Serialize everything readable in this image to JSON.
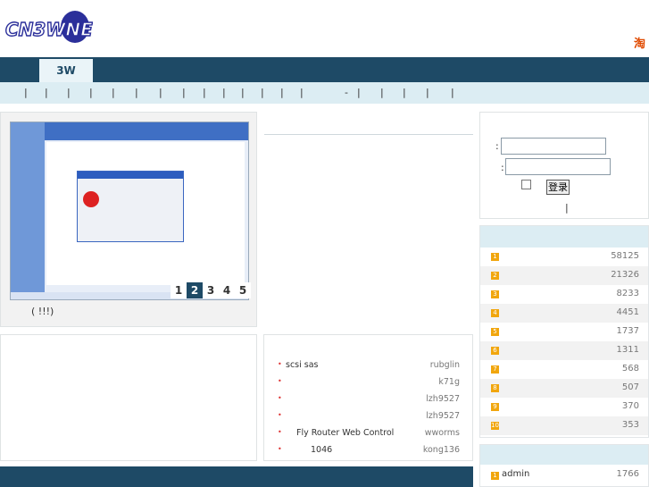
{
  "header": {
    "logo_text": "CN3WNE",
    "right_link": "淘"
  },
  "nav": {
    "active_tab": "3W"
  },
  "subnav": {
    "separators": [
      "|",
      "|",
      "|",
      "|",
      "|",
      "|",
      "|",
      "|",
      "|",
      "|",
      "|",
      "|",
      "|",
      "|",
      "-",
      "|",
      "|",
      "|",
      "|",
      "|"
    ]
  },
  "slideshow": {
    "caption": "(    !!!)",
    "pages": [
      "1",
      "2",
      "3",
      "4",
      "5"
    ],
    "active_page": "2"
  },
  "login": {
    "field1_prefix": ":",
    "field2_prefix": ":",
    "login_button": "登录",
    "divider": "|"
  },
  "ranking": {
    "rows": [
      {
        "num": "1",
        "value": "58125"
      },
      {
        "num": "2",
        "value": "21326"
      },
      {
        "num": "3",
        "value": "8233"
      },
      {
        "num": "4",
        "value": "4451"
      },
      {
        "num": "5",
        "value": "1737"
      },
      {
        "num": "6",
        "value": "1311"
      },
      {
        "num": "7",
        "value": "568"
      },
      {
        "num": "8",
        "value": "507"
      },
      {
        "num": "9",
        "value": "370"
      },
      {
        "num": "10",
        "value": "353"
      }
    ]
  },
  "ranking2": {
    "rows": [
      {
        "num": "1",
        "name": "admin",
        "value": "1766"
      }
    ]
  },
  "posts": [
    {
      "title": "scsi sas",
      "user": "rubglin"
    },
    {
      "title": "",
      "user": "k71g"
    },
    {
      "title": "",
      "user": "lzh9527"
    },
    {
      "title": "",
      "user": "lzh9527"
    },
    {
      "title": "Fly Router Web Control",
      "user": "wworms"
    },
    {
      "title": "1046",
      "user": "kong136"
    }
  ],
  "colors": {
    "nav_bg": "#1e4a66",
    "subnav_bg": "#dcedf3",
    "rank_badge": "#f1a60d",
    "brand_red": "#e04a00"
  }
}
